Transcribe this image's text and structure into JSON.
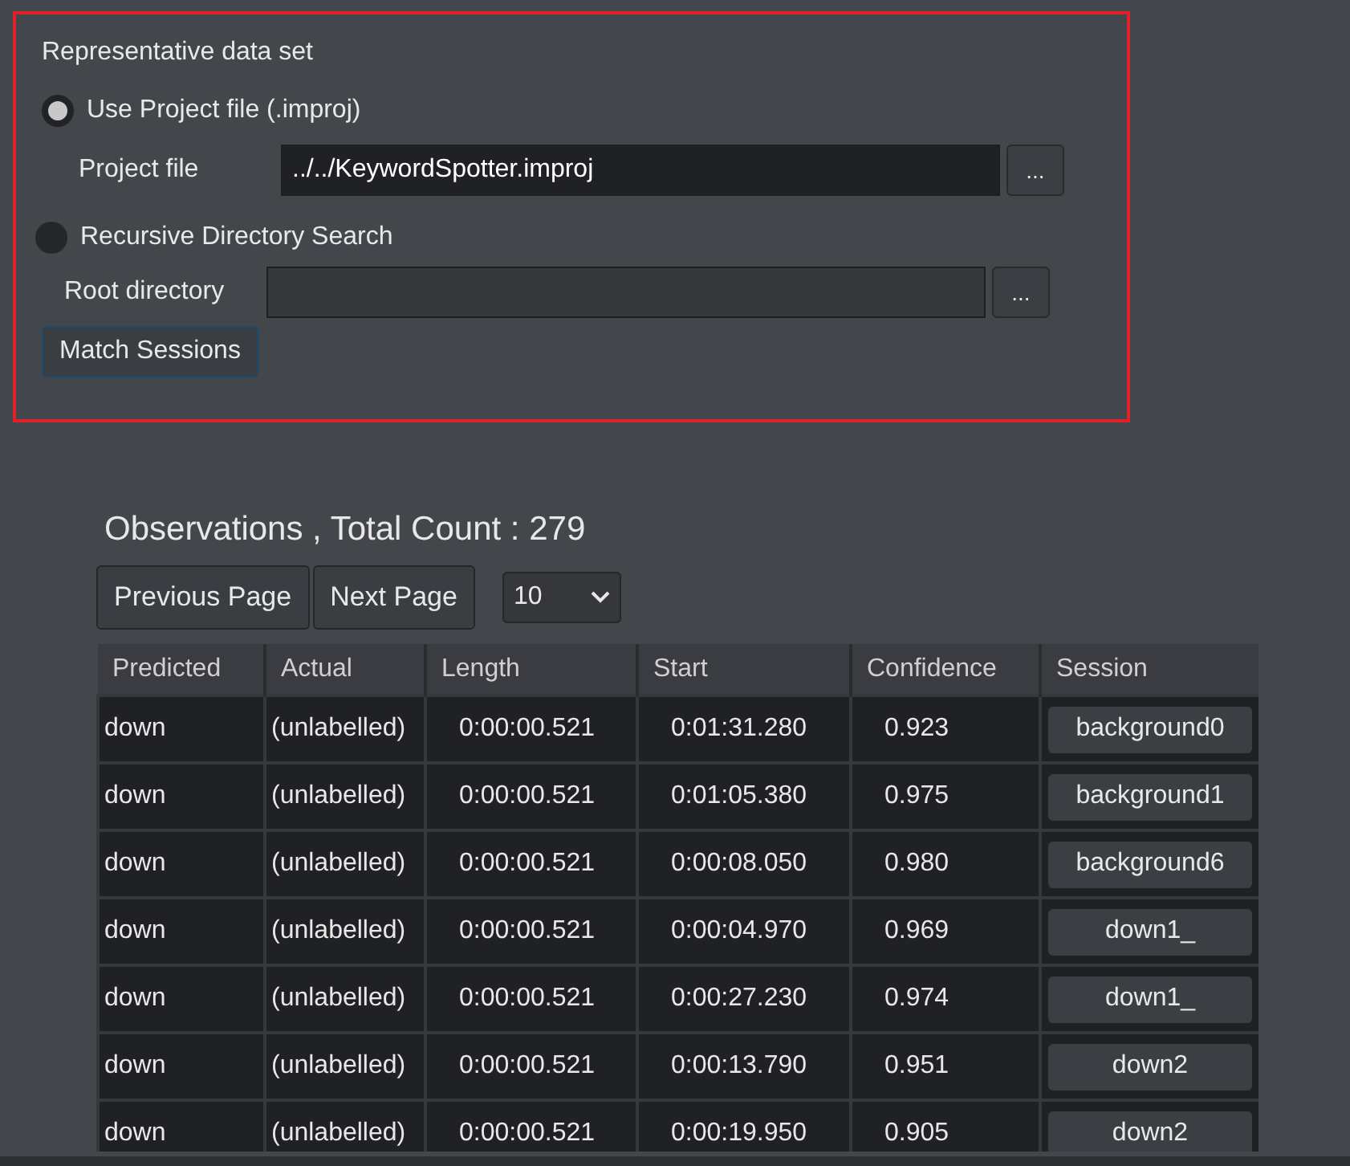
{
  "dataset_panel": {
    "title": "Representative data set",
    "options": [
      {
        "label": "Use Project file (.improj)",
        "selected": true,
        "field_label": "Project file",
        "value": "../../KeywordSpotter.improj",
        "browse": "..."
      },
      {
        "label": "Recursive Directory Search",
        "selected": false,
        "field_label": "Root directory",
        "browse": "..."
      }
    ],
    "action": "Match Sessions"
  },
  "observations": {
    "heading": "Observations , Total Count :  279",
    "buttons": [
      "Previous Page",
      "Next Page"
    ],
    "page_size": "10",
    "table": {
      "columns": [
        "Predicted",
        "Actual",
        "Length",
        "Start",
        "Confidence",
        "Session"
      ],
      "rows": [
        [
          "down",
          "(unlabelled)",
          "0:00:00.521",
          "0:01:31.280",
          "0.923",
          "background0"
        ],
        [
          "down",
          "(unlabelled)",
          "0:00:00.521",
          "0:01:05.380",
          "0.975",
          "background1"
        ],
        [
          "down",
          "(unlabelled)",
          "0:00:00.521",
          "0:00:08.050",
          "0.980",
          "background6"
        ],
        [
          "down",
          "(unlabelled)",
          "0:00:00.521",
          "0:00:04.970",
          "0.969",
          "down1_"
        ],
        [
          "down",
          "(unlabelled)",
          "0:00:00.521",
          "0:00:27.230",
          "0.974",
          "down1_"
        ],
        [
          "down",
          "(unlabelled)",
          "0:00:00.521",
          "0:00:13.790",
          "0.951",
          "down2"
        ],
        [
          "down",
          "(unlabelled)",
          "0:00:00.521",
          "0:00:19.950",
          "0.905",
          "down2"
        ]
      ]
    }
  }
}
